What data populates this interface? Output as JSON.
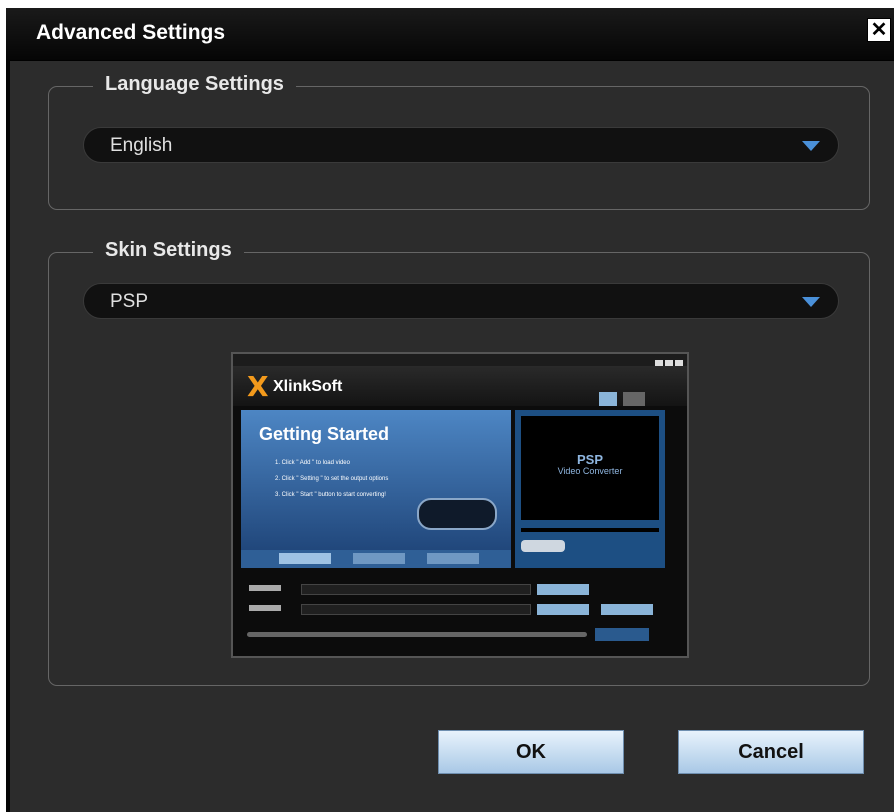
{
  "window": {
    "title": "Advanced Settings",
    "close_glyph": "✕"
  },
  "language": {
    "legend": "Language Settings",
    "selected": "English"
  },
  "skin": {
    "legend": "Skin Settings",
    "selected": "PSP",
    "preview": {
      "brand": "XlinkSoft",
      "heading": "Getting Started",
      "steps": [
        "1. Click \" Add \" to load video",
        "2. Click \" Setting \" to set the output options",
        "3. Click \" Start \" button to start converting!"
      ],
      "screen_logo": "PSP",
      "screen_sub": "Video Converter"
    }
  },
  "buttons": {
    "ok": "OK",
    "cancel": "Cancel"
  },
  "colors": {
    "accent": "#4a90d9",
    "panel": "#2c2c2c",
    "button_top": "#e8f3fc"
  },
  "icons": {
    "close": "close-icon",
    "dropdown": "chevron-down-icon",
    "logo": "xlinksoft-x-logo"
  }
}
